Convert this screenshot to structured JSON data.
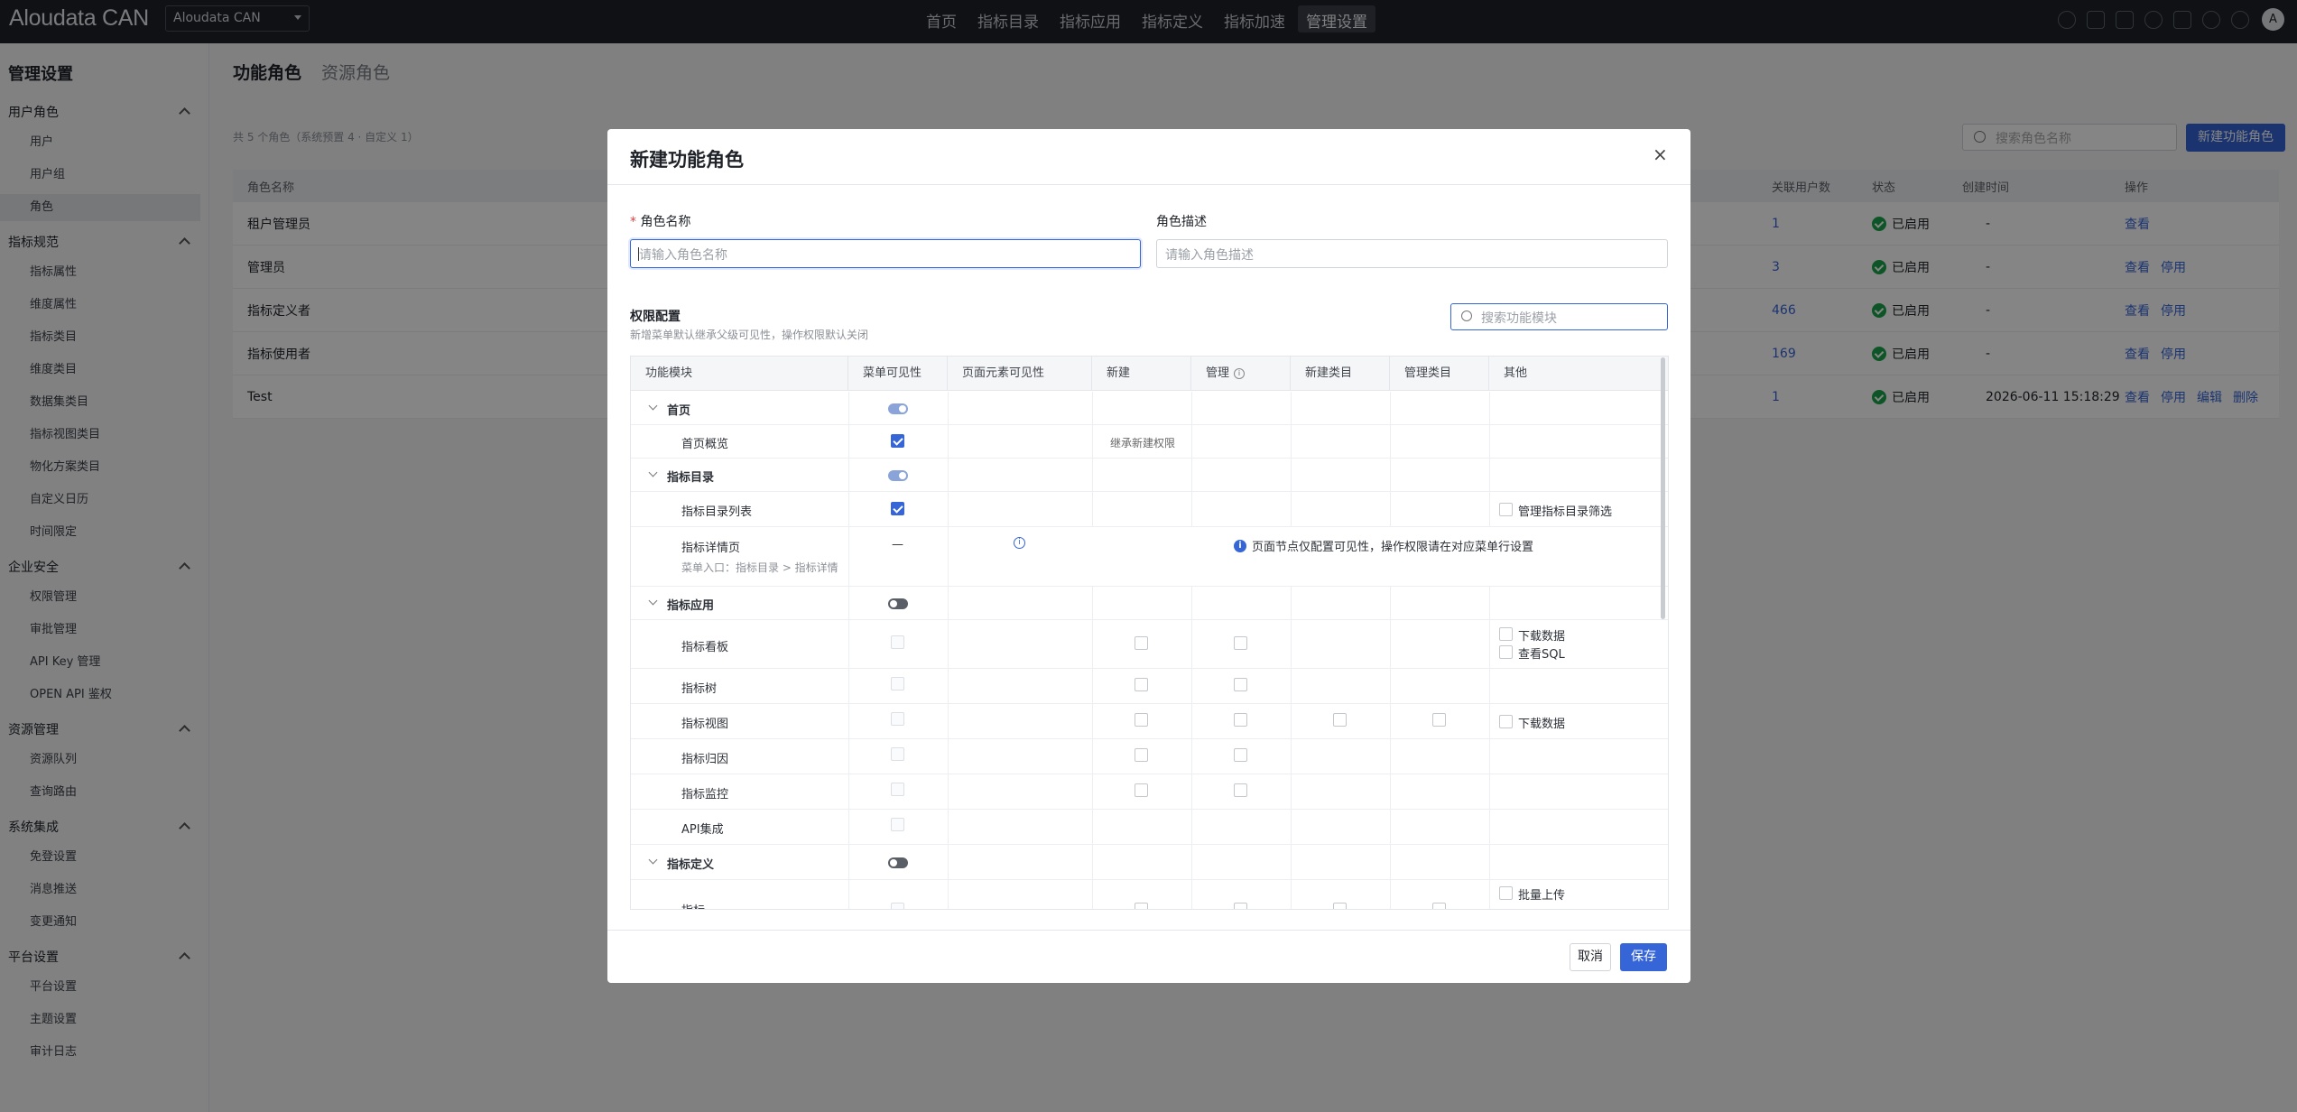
{
  "topbar": {
    "logo": "Aloudata CAN",
    "workspace": "Aloudata CAN",
    "nav": [
      "首页",
      "指标目录",
      "指标应用",
      "指标定义",
      "指标加速",
      "管理设置"
    ],
    "active_nav": "管理设置",
    "avatar": "A"
  },
  "sidebar": {
    "title": "管理设置",
    "groups": [
      {
        "label": "用户角色",
        "items": [
          "用户",
          "用户组",
          "角色"
        ]
      },
      {
        "label": "指标规范",
        "items": [
          "指标属性",
          "维度属性",
          "指标类目",
          "维度类目",
          "数据集类目",
          "指标视图类目",
          "物化方案类目",
          "自定义日历",
          "时间限定"
        ]
      },
      {
        "label": "企业安全",
        "items": [
          "权限管理",
          "审批管理",
          "API Key 管理",
          "OPEN API 鉴权"
        ]
      },
      {
        "label": "资源管理",
        "items": [
          "资源队列",
          "查询路由"
        ]
      },
      {
        "label": "系统集成",
        "items": [
          "免登设置",
          "消息推送",
          "变更通知"
        ]
      },
      {
        "label": "平台设置",
        "items": [
          "平台设置",
          "主题设置",
          "审计日志"
        ]
      }
    ],
    "active_item": "角色"
  },
  "main": {
    "tabs": [
      "功能角色",
      "资源角色"
    ],
    "count_text": "共 5 个角色（系统预置 4 · 自定义 1）",
    "search_placeholder": "搜索角色名称",
    "new_button": "新建功能角色",
    "columns": {
      "name": "角色名称",
      "users": "关联用户数",
      "status": "状态",
      "created": "创建时间",
      "ops": "操作"
    },
    "rows": [
      {
        "name": "租户管理员",
        "users": "1",
        "status": "已启用",
        "created": "-",
        "ops": [
          "查看"
        ]
      },
      {
        "name": "管理员",
        "users": "3",
        "status": "已启用",
        "created": "-",
        "ops": [
          "查看",
          "停用"
        ]
      },
      {
        "name": "指标定义者",
        "users": "466",
        "status": "已启用",
        "created": "-",
        "ops": [
          "查看",
          "停用"
        ]
      },
      {
        "name": "指标使用者",
        "users": "169",
        "status": "已启用",
        "created": "-",
        "ops": [
          "查看",
          "停用"
        ]
      },
      {
        "name": "Test",
        "users": "1",
        "status": "已启用",
        "created": "2026-06-11 15:18:29",
        "ops": [
          "查看",
          "停用",
          "编辑",
          "删除"
        ]
      }
    ]
  },
  "modal": {
    "title": "新建功能角色",
    "close": "×",
    "name_label": "角色名称",
    "name_required": "*",
    "name_placeholder": "请输入角色名称",
    "desc_label": "角色描述",
    "desc_placeholder": "请输入角色描述",
    "perm_title": "权限配置",
    "perm_sub": "新增菜单默认继承父级可见性，操作权限默认关闭",
    "perm_search_placeholder": "搜索功能模块",
    "headers": [
      "功能模块",
      "菜单可见性",
      "页面元素可见性",
      "新建",
      "管理",
      "新建类目",
      "管理类目",
      "其他"
    ],
    "rows": [
      {
        "label": "首页",
        "group": true,
        "menu": "toggle-on"
      },
      {
        "label": "首页概览",
        "menu": "checked",
        "create_text": "继承新建权限"
      },
      {
        "label": "指标目录",
        "group": true,
        "menu": "toggle-on"
      },
      {
        "label": "指标目录列表",
        "menu": "checked",
        "other": [
          "管理指标目录筛选"
        ]
      },
      {
        "label": "指标详情页",
        "sub": "菜单入口：指标目录 > 指标详情",
        "menu": "—",
        "note": "页面节点仅配置可见性，操作权限请在对应菜单行设置"
      },
      {
        "label": "指标应用",
        "group": true,
        "menu": "toggle-off"
      },
      {
        "label": "指标看板",
        "menu": "disabled",
        "other": [
          "下载数据",
          "查看SQL"
        ]
      },
      {
        "label": "指标树",
        "menu": "disabled"
      },
      {
        "label": "指标视图",
        "menu": "disabled",
        "other": [
          "下载数据"
        ]
      },
      {
        "label": "指标归因",
        "menu": "disabled"
      },
      {
        "label": "指标监控",
        "menu": "disabled"
      },
      {
        "label": "API集成",
        "menu": "disabled"
      },
      {
        "label": "指标定义",
        "group": true,
        "menu": "toggle-off"
      },
      {
        "label": "指标",
        "menu": "disabled",
        "other": [
          "批量上传"
        ]
      }
    ],
    "cancel": "取消",
    "save": "保存"
  }
}
